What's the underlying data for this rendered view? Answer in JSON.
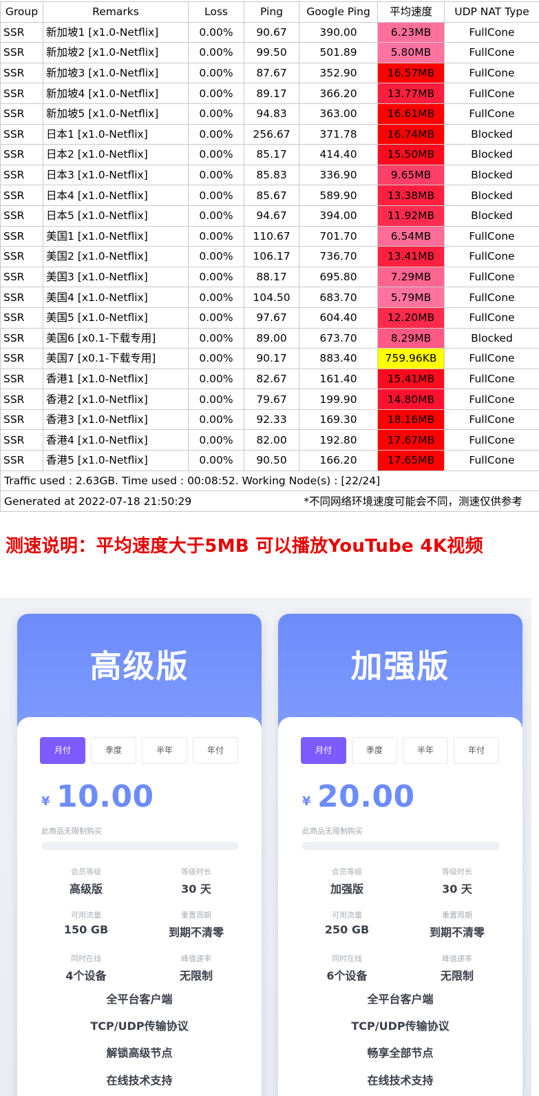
{
  "table": {
    "headers": [
      "Group",
      "Remarks",
      "Loss",
      "Ping",
      "Google Ping",
      "平均速度",
      "UDP NAT Type"
    ],
    "rows": [
      {
        "group": "SSR",
        "remarks": "新加坡1 [x1.0-Netflix]",
        "loss": "0.00%",
        "ping": "90.67",
        "gping": "390.00",
        "speed": "6.23MB",
        "speed_color": "#ff6f9c",
        "nat": "FullCone"
      },
      {
        "group": "SSR",
        "remarks": "新加坡2 [x1.0-Netflix]",
        "loss": "0.00%",
        "ping": "99.50",
        "gping": "501.89",
        "speed": "5.80MB",
        "speed_color": "#ff73a0",
        "nat": "FullCone"
      },
      {
        "group": "SSR",
        "remarks": "新加坡3 [x1.0-Netflix]",
        "loss": "0.00%",
        "ping": "87.67",
        "gping": "352.90",
        "speed": "16.57MB",
        "speed_color": "#ff0000",
        "nat": "FullCone"
      },
      {
        "group": "SSR",
        "remarks": "新加坡4 [x1.0-Netflix]",
        "loss": "0.00%",
        "ping": "89.17",
        "gping": "366.20",
        "speed": "13.77MB",
        "speed_color": "#ff1e3c",
        "nat": "FullCone"
      },
      {
        "group": "SSR",
        "remarks": "新加坡5 [x1.0-Netflix]",
        "loss": "0.00%",
        "ping": "94.83",
        "gping": "363.00",
        "speed": "16.61MB",
        "speed_color": "#ff0000",
        "nat": "FullCone"
      },
      {
        "group": "SSR",
        "remarks": "日本1 [x1.0-Netflix]",
        "loss": "0.00%",
        "ping": "256.67",
        "gping": "371.78",
        "speed": "16.74MB",
        "speed_color": "#ff0000",
        "nat": "Blocked"
      },
      {
        "group": "SSR",
        "remarks": "日本2 [x1.0-Netflix]",
        "loss": "0.00%",
        "ping": "85.17",
        "gping": "414.40",
        "speed": "15.50MB",
        "speed_color": "#ff0a1e",
        "nat": "Blocked"
      },
      {
        "group": "SSR",
        "remarks": "日本3 [x1.0-Netflix]",
        "loss": "0.00%",
        "ping": "85.83",
        "gping": "336.90",
        "speed": "9.65MB",
        "speed_color": "#ff4068",
        "nat": "Blocked"
      },
      {
        "group": "SSR",
        "remarks": "日本4 [x1.0-Netflix]",
        "loss": "0.00%",
        "ping": "85.67",
        "gping": "589.90",
        "speed": "13.38MB",
        "speed_color": "#ff2040",
        "nat": "Blocked"
      },
      {
        "group": "SSR",
        "remarks": "日本5 [x1.0-Netflix]",
        "loss": "0.00%",
        "ping": "94.67",
        "gping": "394.00",
        "speed": "11.92MB",
        "speed_color": "#ff2c50",
        "nat": "Blocked"
      },
      {
        "group": "SSR",
        "remarks": "美国1 [x1.0-Netflix]",
        "loss": "0.00%",
        "ping": "110.67",
        "gping": "701.70",
        "speed": "6.54MB",
        "speed_color": "#ff6c98",
        "nat": "FullCone"
      },
      {
        "group": "SSR",
        "remarks": "美国2 [x1.0-Netflix]",
        "loss": "0.00%",
        "ping": "106.17",
        "gping": "736.70",
        "speed": "13.41MB",
        "speed_color": "#ff2040",
        "nat": "FullCone"
      },
      {
        "group": "SSR",
        "remarks": "美国3 [x1.0-Netflix]",
        "loss": "0.00%",
        "ping": "88.17",
        "gping": "695.80",
        "speed": "7.29MB",
        "speed_color": "#ff6590",
        "nat": "FullCone"
      },
      {
        "group": "SSR",
        "remarks": "美国4 [x1.0-Netflix]",
        "loss": "0.00%",
        "ping": "104.50",
        "gping": "683.70",
        "speed": "5.79MB",
        "speed_color": "#ff73a0",
        "nat": "FullCone"
      },
      {
        "group": "SSR",
        "remarks": "美国5 [x1.0-Netflix]",
        "loss": "0.00%",
        "ping": "97.67",
        "gping": "604.40",
        "speed": "12.20MB",
        "speed_color": "#ff2a4c",
        "nat": "FullCone"
      },
      {
        "group": "SSR",
        "remarks": "美国6 [x0.1-下载专用]",
        "loss": "0.00%",
        "ping": "89.00",
        "gping": "673.70",
        "speed": "8.29MB",
        "speed_color": "#ff5a86",
        "nat": "Blocked"
      },
      {
        "group": "SSR",
        "remarks": "美国7 [x0.1-下载专用]",
        "loss": "0.00%",
        "ping": "90.17",
        "gping": "883.40",
        "speed": "759.96KB",
        "speed_color": "#ffff00",
        "nat": "FullCone"
      },
      {
        "group": "SSR",
        "remarks": "香港1 [x1.0-Netflix]",
        "loss": "0.00%",
        "ping": "82.67",
        "gping": "161.40",
        "speed": "15.41MB",
        "speed_color": "#ff0a1e",
        "nat": "FullCone"
      },
      {
        "group": "SSR",
        "remarks": "香港2 [x1.0-Netflix]",
        "loss": "0.00%",
        "ping": "79.67",
        "gping": "199.90",
        "speed": "14.80MB",
        "speed_color": "#ff1230",
        "nat": "FullCone"
      },
      {
        "group": "SSR",
        "remarks": "香港3 [x1.0-Netflix]",
        "loss": "0.00%",
        "ping": "92.33",
        "gping": "169.30",
        "speed": "18.16MB",
        "speed_color": "#ff0000",
        "nat": "FullCone"
      },
      {
        "group": "SSR",
        "remarks": "香港4 [x1.0-Netflix]",
        "loss": "0.00%",
        "ping": "82.00",
        "gping": "192.80",
        "speed": "17.67MB",
        "speed_color": "#ff0000",
        "nat": "FullCone"
      },
      {
        "group": "SSR",
        "remarks": "香港5 [x1.0-Netflix]",
        "loss": "0.00%",
        "ping": "90.50",
        "gping": "166.20",
        "speed": "17.65MB",
        "speed_color": "#ff0000",
        "nat": "FullCone"
      }
    ],
    "traffic_line": "Traffic used : 2.63GB. Time used : 00:08:52. Working Node(s) : [22/24]",
    "generated_at": "Generated at 2022-07-18 21:50:29",
    "disclaimer": "*不同网络环境速度可能会不同，测速仅供参考",
    "header_speed_color": "#ffffff"
  },
  "headline": "测速说明：平均速度大于5MB 可以播放YouTube 4K视频",
  "plans": [
    {
      "title": "高级版",
      "tabs": [
        "月付",
        "季度",
        "半年",
        "年付"
      ],
      "active_tab": 0,
      "currency": "¥",
      "price": "10.00",
      "limit_note": "此商品无限制购买",
      "specs": [
        {
          "label": "会员等级",
          "value": "高级版"
        },
        {
          "label": "等级时长",
          "value": "30 天"
        },
        {
          "label": "可用流量",
          "value": "150 GB"
        },
        {
          "label": "重置周期",
          "value": "到期不清零"
        },
        {
          "label": "同时在线",
          "value": "4个设备"
        },
        {
          "label": "峰值速率",
          "value": "无限制"
        }
      ],
      "features": [
        "全平台客户端",
        "TCP/UDP传输协议",
        "解锁高级节点",
        "在线技术支持"
      ]
    },
    {
      "title": "加强版",
      "tabs": [
        "月付",
        "季度",
        "半年",
        "年付"
      ],
      "active_tab": 0,
      "currency": "¥",
      "price": "20.00",
      "limit_note": "此商品无限制购买",
      "specs": [
        {
          "label": "会员等级",
          "value": "加强版"
        },
        {
          "label": "等级时长",
          "value": "30 天"
        },
        {
          "label": "可用流量",
          "value": "250 GB"
        },
        {
          "label": "重置周期",
          "value": "到期不清零"
        },
        {
          "label": "同时在线",
          "value": "6个设备"
        },
        {
          "label": "峰值速率",
          "value": "无限制"
        }
      ],
      "features": [
        "全平台客户端",
        "TCP/UDP传输协议",
        "畅享全部节点",
        "在线技术支持"
      ]
    }
  ],
  "colors": {
    "accent_blue": "#6d8cfb",
    "active_tab_purple": "#7c5cff",
    "headline_red": "#e60000"
  }
}
